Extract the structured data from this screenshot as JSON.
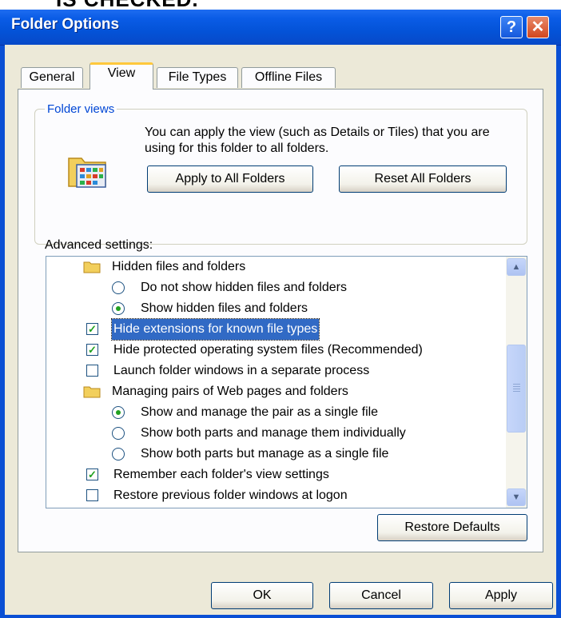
{
  "caption": "IS CHECKED.",
  "window": {
    "title": "Folder Options",
    "help_glyph": "?",
    "close_glyph": "✕"
  },
  "tabs": [
    {
      "label": "General",
      "active": false
    },
    {
      "label": "View",
      "active": true
    },
    {
      "label": "File Types",
      "active": false
    },
    {
      "label": "Offline Files",
      "active": false
    }
  ],
  "folder_views": {
    "label": "Folder views",
    "description": "You can apply the view (such as Details or Tiles) that you are using for this folder to all folders.",
    "apply_button": "Apply to All Folders",
    "reset_button": "Reset All Folders"
  },
  "advanced": {
    "label": "Advanced settings:",
    "items": [
      {
        "kind": "folder",
        "text": "Hidden files and folders"
      },
      {
        "kind": "radio",
        "text": "Do not show hidden files and folders",
        "checked": false
      },
      {
        "kind": "radio",
        "text": "Show hidden files and folders",
        "checked": true
      },
      {
        "kind": "checkbox",
        "text": "Hide extensions for known file types",
        "checked": true,
        "selected": true
      },
      {
        "kind": "checkbox",
        "text": "Hide protected operating system files (Recommended)",
        "checked": true
      },
      {
        "kind": "checkbox",
        "text": "Launch folder windows in a separate process",
        "checked": false
      },
      {
        "kind": "folder",
        "text": "Managing pairs of Web pages and folders"
      },
      {
        "kind": "radio",
        "text": "Show and manage the pair as a single file",
        "checked": true
      },
      {
        "kind": "radio",
        "text": "Show both parts and manage them individually",
        "checked": false
      },
      {
        "kind": "radio",
        "text": "Show both parts but manage as a single file",
        "checked": false
      },
      {
        "kind": "checkbox",
        "text": "Remember each folder's view settings",
        "checked": true
      },
      {
        "kind": "checkbox",
        "text": "Restore previous folder windows at logon",
        "checked": false
      }
    ],
    "restore_defaults": "Restore Defaults"
  },
  "footer": {
    "ok": "OK",
    "cancel": "Cancel",
    "apply": "Apply"
  },
  "colors": {
    "titlebar": "#0453d8",
    "dialog_bg": "#ece9d8",
    "selection": "#316ac5",
    "check": "#21a121",
    "group_label": "#0046d5"
  }
}
